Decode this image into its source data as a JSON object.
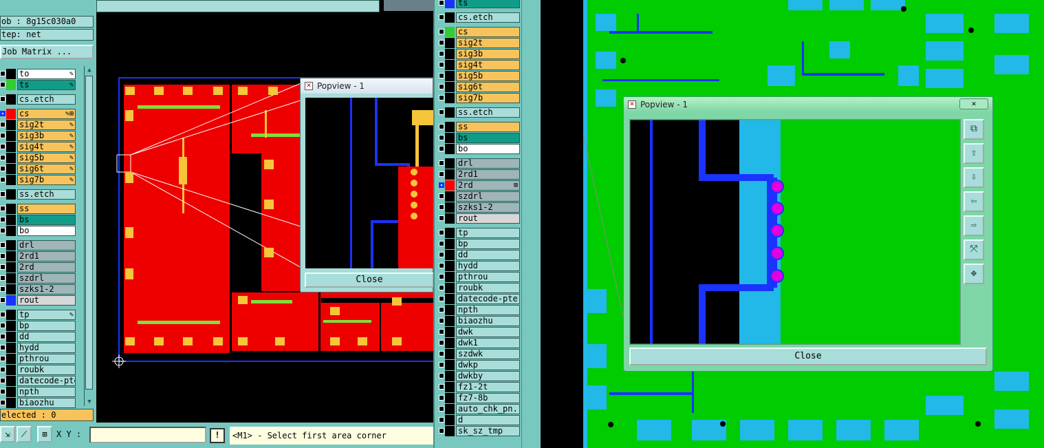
{
  "job_info": {
    "job": "ob : 8g15c030a0",
    "step": "tep: net",
    "job_matrix": "Job Matrix ..."
  },
  "left_layers": [
    {
      "name": "to",
      "fill": "#ffffff",
      "sw": "#000000",
      "mark": "✎",
      "cb": "plain"
    },
    {
      "name": "ts",
      "fill": "#119c88",
      "sw": "#33cc33",
      "mark": "✎",
      "cb": "plain"
    },
    {
      "name": "cs.etch",
      "fill": "#a8ddd9",
      "sw": "#000000",
      "mark": "",
      "cb": "plain"
    },
    {
      "name": "cs",
      "fill": "#f7c35a",
      "sw": "#ff0000",
      "mark": "✎⊞",
      "cb": "sel"
    },
    {
      "name": "sig2t",
      "fill": "#f7c35a",
      "sw": "#000000",
      "mark": "✎",
      "cb": "plain"
    },
    {
      "name": "sig3b",
      "fill": "#f7c35a",
      "sw": "#000000",
      "mark": "✎",
      "cb": "plain"
    },
    {
      "name": "sig4t",
      "fill": "#f7c35a",
      "sw": "#000000",
      "mark": "✎",
      "cb": "plain"
    },
    {
      "name": "sig5b",
      "fill": "#f7c35a",
      "sw": "#000000",
      "mark": "✎",
      "cb": "plain"
    },
    {
      "name": "sig6t",
      "fill": "#f7c35a",
      "sw": "#000000",
      "mark": "✎",
      "cb": "plain"
    },
    {
      "name": "sig7b",
      "fill": "#f7c35a",
      "sw": "#000000",
      "mark": "✎",
      "cb": "plain"
    },
    {
      "name": "ss.etch",
      "fill": "#a8ddd9",
      "sw": "#000000",
      "mark": "",
      "cb": "plain"
    },
    {
      "name": "ss",
      "fill": "#f7c35a",
      "sw": "#000000",
      "mark": "",
      "cb": "plain"
    },
    {
      "name": "bs",
      "fill": "#119c88",
      "sw": "#000000",
      "mark": "",
      "cb": "plain"
    },
    {
      "name": "bo",
      "fill": "#ffffff",
      "sw": "#000000",
      "mark": "",
      "cb": "plain"
    },
    {
      "name": "drl",
      "fill": "#9fb5b8",
      "sw": "#000000",
      "mark": "",
      "cb": "plain"
    },
    {
      "name": "2rd1",
      "fill": "#9fb5b8",
      "sw": "#000000",
      "mark": "",
      "cb": "plain"
    },
    {
      "name": "2rd",
      "fill": "#9fb5b8",
      "sw": "#000000",
      "mark": "",
      "cb": "plain"
    },
    {
      "name": "szdrl",
      "fill": "#9fb5b8",
      "sw": "#000000",
      "mark": "",
      "cb": "plain"
    },
    {
      "name": "szks1-2",
      "fill": "#9fb5b8",
      "sw": "#000000",
      "mark": "",
      "cb": "plain"
    },
    {
      "name": "rout",
      "fill": "#d7d7d7",
      "sw": "#1a33ff",
      "mark": "",
      "cb": "plain"
    },
    {
      "name": "tp",
      "fill": "#a8ddd9",
      "sw": "#000000",
      "mark": "✎",
      "cb": "plain"
    },
    {
      "name": "bp",
      "fill": "#a8ddd9",
      "sw": "#000000",
      "mark": "",
      "cb": "plain"
    },
    {
      "name": "dd",
      "fill": "#a8ddd9",
      "sw": "#000000",
      "mark": "",
      "cb": "plain"
    },
    {
      "name": "hydd",
      "fill": "#a8ddd9",
      "sw": "#000000",
      "mark": "",
      "cb": "plain"
    },
    {
      "name": "pthrou",
      "fill": "#a8ddd9",
      "sw": "#000000",
      "mark": "",
      "cb": "plain"
    },
    {
      "name": "roubk",
      "fill": "#a8ddd9",
      "sw": "#000000",
      "mark": "",
      "cb": "plain"
    },
    {
      "name": "datecode-pte",
      "fill": "#a8ddd9",
      "sw": "#000000",
      "mark": "",
      "cb": "plain"
    },
    {
      "name": "npth",
      "fill": "#a8ddd9",
      "sw": "#000000",
      "mark": "",
      "cb": "plain"
    },
    {
      "name": "biaozhu",
      "fill": "#a8ddd9",
      "sw": "#000000",
      "mark": "",
      "cb": "plain"
    }
  ],
  "mid_layers": [
    {
      "name": "ts",
      "fill": "#119c88",
      "sw": "#1a33ff",
      "mark": "",
      "cb": "plain"
    },
    {
      "name": "cs.etch",
      "fill": "#a8ddd9",
      "sw": "#000000",
      "mark": "",
      "cb": "plain"
    },
    {
      "name": "cs",
      "fill": "#f7c35a",
      "sw": "#33cc33",
      "mark": "",
      "cb": "plain"
    },
    {
      "name": "sig2t",
      "fill": "#f7c35a",
      "sw": "#000000",
      "mark": "",
      "cb": "plain"
    },
    {
      "name": "sig3b",
      "fill": "#f7c35a",
      "sw": "#000000",
      "mark": "",
      "cb": "plain"
    },
    {
      "name": "sig4t",
      "fill": "#f7c35a",
      "sw": "#000000",
      "mark": "",
      "cb": "plain"
    },
    {
      "name": "sig5b",
      "fill": "#f7c35a",
      "sw": "#000000",
      "mark": "",
      "cb": "plain"
    },
    {
      "name": "sig6t",
      "fill": "#f7c35a",
      "sw": "#000000",
      "mark": "",
      "cb": "plain"
    },
    {
      "name": "sig7b",
      "fill": "#f7c35a",
      "sw": "#000000",
      "mark": "",
      "cb": "plain"
    },
    {
      "name": "ss.etch",
      "fill": "#a8ddd9",
      "sw": "#000000",
      "mark": "",
      "cb": "plain"
    },
    {
      "name": "ss",
      "fill": "#f7c35a",
      "sw": "#000000",
      "mark": "",
      "cb": "plain"
    },
    {
      "name": "bs",
      "fill": "#119c88",
      "sw": "#000000",
      "mark": "",
      "cb": "plain"
    },
    {
      "name": "bo",
      "fill": "#ffffff",
      "sw": "#000000",
      "mark": "",
      "cb": "plain"
    },
    {
      "name": "drl",
      "fill": "#9fb5b8",
      "sw": "#000000",
      "mark": "",
      "cb": "plain"
    },
    {
      "name": "2rd1",
      "fill": "#9fb5b8",
      "sw": "#000000",
      "mark": "",
      "cb": "plain"
    },
    {
      "name": "2rd",
      "fill": "#9fb5b8",
      "sw": "#ff0000",
      "mark": "⊞",
      "cb": "sel"
    },
    {
      "name": "szdrl",
      "fill": "#9fb5b8",
      "sw": "#000000",
      "mark": "",
      "cb": "plain"
    },
    {
      "name": "szks1-2",
      "fill": "#9fb5b8",
      "sw": "#000000",
      "mark": "",
      "cb": "plain"
    },
    {
      "name": "rout",
      "fill": "#d7d7d7",
      "sw": "#000000",
      "mark": "",
      "cb": "plain"
    },
    {
      "name": "tp",
      "fill": "#a8ddd9",
      "sw": "#000000",
      "mark": "",
      "cb": "plain"
    },
    {
      "name": "bp",
      "fill": "#a8ddd9",
      "sw": "#000000",
      "mark": "",
      "cb": "plain"
    },
    {
      "name": "dd",
      "fill": "#a8ddd9",
      "sw": "#000000",
      "mark": "",
      "cb": "plain"
    },
    {
      "name": "hydd",
      "fill": "#a8ddd9",
      "sw": "#000000",
      "mark": "",
      "cb": "plain"
    },
    {
      "name": "pthrou",
      "fill": "#a8ddd9",
      "sw": "#000000",
      "mark": "",
      "cb": "plain"
    },
    {
      "name": "roubk",
      "fill": "#a8ddd9",
      "sw": "#000000",
      "mark": "",
      "cb": "plain"
    },
    {
      "name": "datecode-pte",
      "fill": "#a8ddd9",
      "sw": "#000000",
      "mark": "",
      "cb": "plain"
    },
    {
      "name": "npth",
      "fill": "#a8ddd9",
      "sw": "#000000",
      "mark": "",
      "cb": "plain"
    },
    {
      "name": "biaozhu",
      "fill": "#a8ddd9",
      "sw": "#000000",
      "mark": "",
      "cb": "plain"
    },
    {
      "name": "dwk",
      "fill": "#a8ddd9",
      "sw": "#000000",
      "mark": "",
      "cb": "plain"
    },
    {
      "name": "dwk1",
      "fill": "#a8ddd9",
      "sw": "#000000",
      "mark": "",
      "cb": "plain"
    },
    {
      "name": "szdwk",
      "fill": "#a8ddd9",
      "sw": "#000000",
      "mark": "",
      "cb": "plain"
    },
    {
      "name": "dwkp",
      "fill": "#a8ddd9",
      "sw": "#000000",
      "mark": "",
      "cb": "plain"
    },
    {
      "name": "dwkby",
      "fill": "#a8ddd9",
      "sw": "#000000",
      "mark": "",
      "cb": "plain"
    },
    {
      "name": "fz1-2t",
      "fill": "#a8ddd9",
      "sw": "#000000",
      "mark": "",
      "cb": "plain"
    },
    {
      "name": "fz7-8b",
      "fill": "#a8ddd9",
      "sw": "#000000",
      "mark": "",
      "cb": "plain"
    },
    {
      "name": "auto_chk_pn.",
      "fill": "#a8ddd9",
      "sw": "#000000",
      "mark": "",
      "cb": "plain"
    },
    {
      "name": "d",
      "fill": "#a8ddd9",
      "sw": "#000000",
      "mark": "",
      "cb": "plain"
    },
    {
      "name": "sk_sz_tmp",
      "fill": "#a8ddd9",
      "sw": "#000000",
      "mark": "",
      "cb": "plain"
    }
  ],
  "selected": "elected : 0",
  "bottom": {
    "xy_label": "X Y :",
    "xy_value": "",
    "excl": "!",
    "status": "<M1> - Select first area corner"
  },
  "popview1": {
    "title": "Popview - 1",
    "close": "Close"
  },
  "popview2": {
    "title": "Popview - 1",
    "close": "Close",
    "x": "✕"
  },
  "colors": {
    "panel": "#78c8c0",
    "field": "#a8ddd9",
    "copper_red": "#ee0000",
    "pad_yellow": "#f6c53a",
    "board_green": "#00cc00",
    "pad_blue": "#22b8e8",
    "trace_blue": "#1a33ff",
    "via_magenta": "#e000e0"
  },
  "icons": {
    "tool1": "zoom-area-icon",
    "tool2": "zoom-measure-icon",
    "tool3": "grid-icon",
    "pv2_side": [
      "zoom-fit-icon",
      "pan-up-icon",
      "pan-down-icon",
      "pan-left-icon",
      "pan-right-icon",
      "zoom-out-icon",
      "zoom-in-icon"
    ]
  }
}
